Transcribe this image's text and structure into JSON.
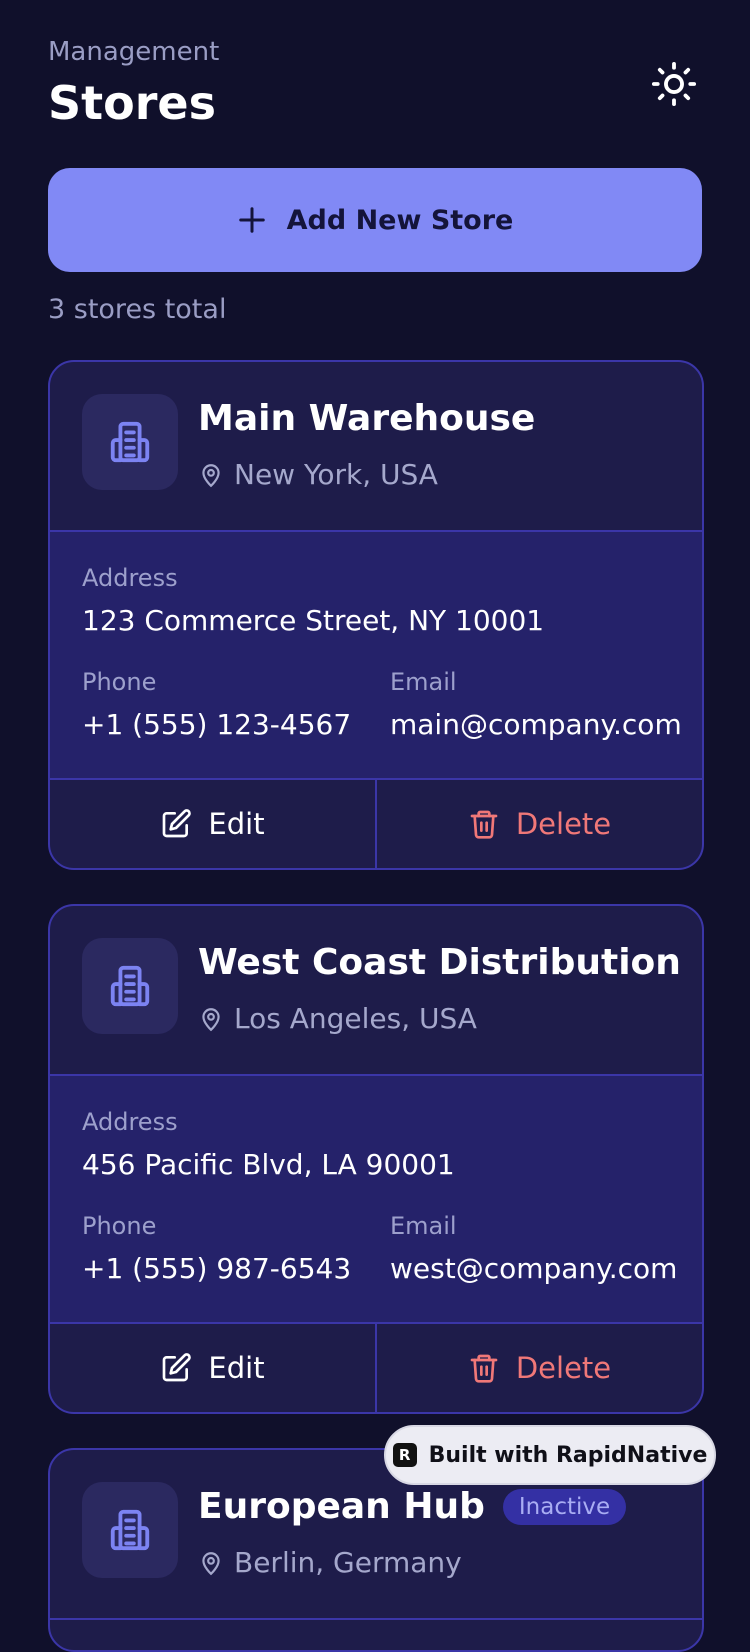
{
  "header": {
    "eyebrow": "Management",
    "title": "Stores"
  },
  "add_button": {
    "label": "Add New Store"
  },
  "summary": {
    "total_text": "3 stores total"
  },
  "labels": {
    "address": "Address",
    "phone": "Phone",
    "email": "Email",
    "edit": "Edit",
    "delete": "Delete"
  },
  "stores": [
    {
      "name": "Main Warehouse",
      "location": "New York, USA",
      "address": "123 Commerce Street, NY 10001",
      "phone": "+1 (555) 123-4567",
      "email": "main@company.com"
    },
    {
      "name": "West Coast Distribution",
      "location": "Los Angeles, USA",
      "address": "456 Pacific Blvd, LA 90001",
      "phone": "+1 (555) 987-6543",
      "email": "west@company.com"
    },
    {
      "name": "European Hub",
      "status_badge": "Inactive",
      "location": "Berlin, Germany"
    }
  ],
  "branding": {
    "badge_text": "Built with RapidNative",
    "logo_letter": "R"
  },
  "colors": {
    "background": "#10102b",
    "accent": "#8189f5",
    "card": "#1e1c4a",
    "card_body": "#25226a",
    "border": "#3b36a8",
    "danger": "#f07878"
  },
  "icons": {
    "theme": "sun-icon",
    "add": "plus-icon",
    "store": "building-icon",
    "location": "map-pin-icon",
    "edit": "edit-icon",
    "delete": "trash-icon"
  }
}
